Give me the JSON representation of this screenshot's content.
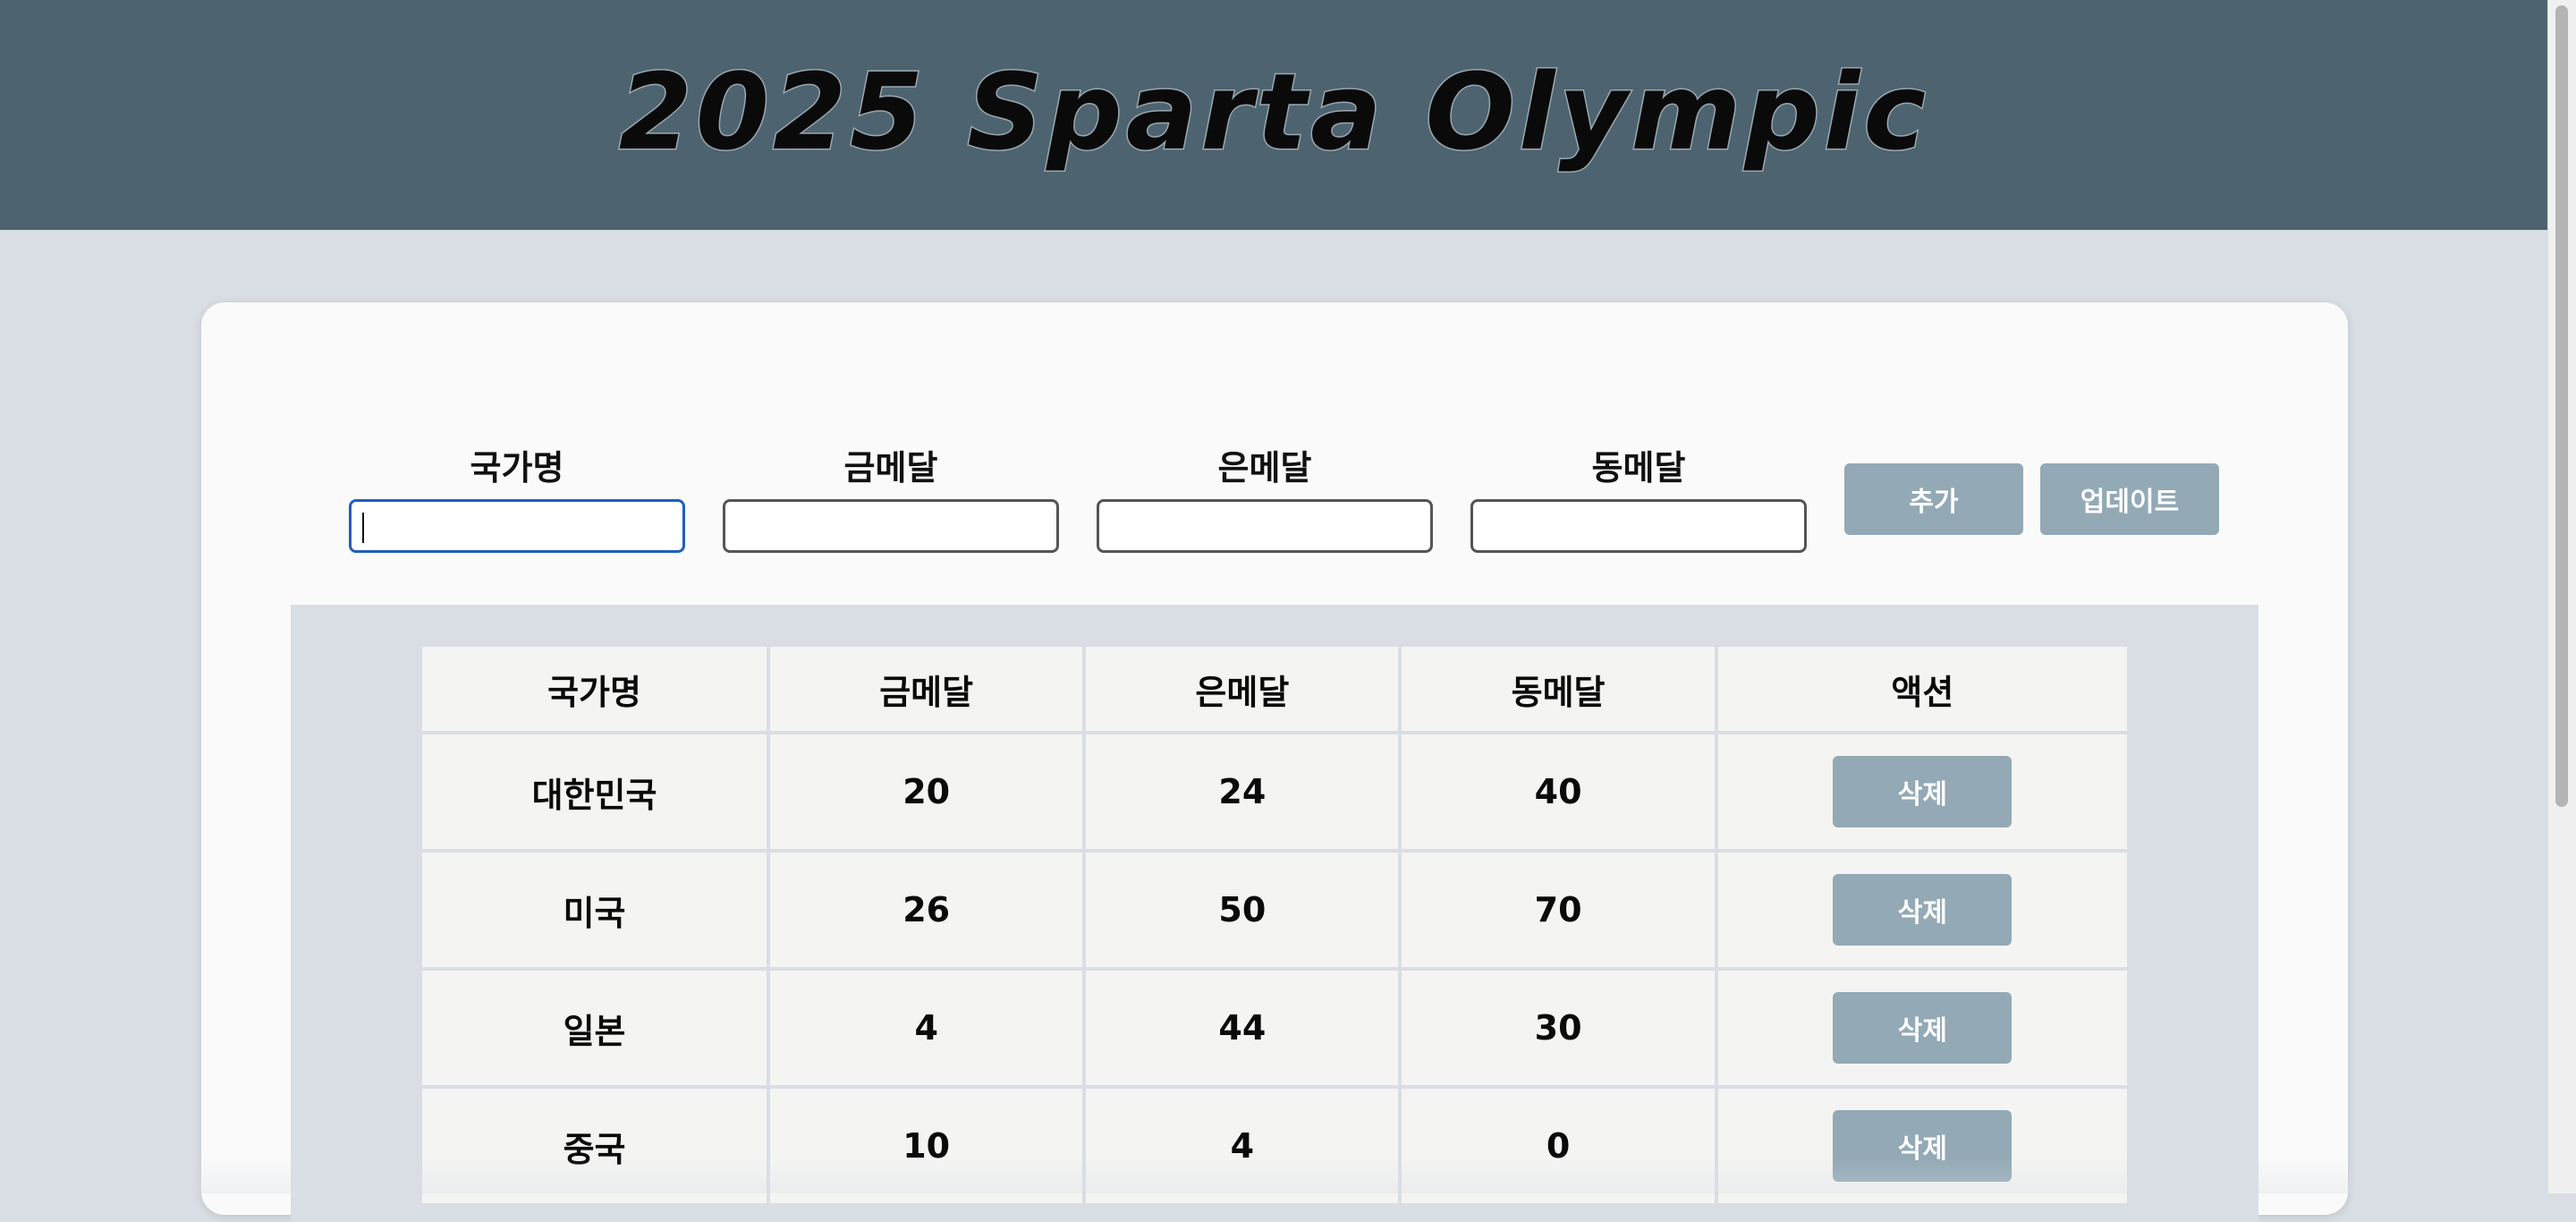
{
  "header": {
    "title": "2025 Sparta Olympic"
  },
  "form": {
    "fields": [
      {
        "label": "국가명",
        "value": ""
      },
      {
        "label": "금메달",
        "value": ""
      },
      {
        "label": "은메달",
        "value": ""
      },
      {
        "label": "동메달",
        "value": ""
      }
    ],
    "add_label": "추가",
    "update_label": "업데이트"
  },
  "table": {
    "headers": [
      "국가명",
      "금메달",
      "은메달",
      "동메달",
      "액션"
    ],
    "rows": [
      {
        "country": "대한민국",
        "gold": "20",
        "silver": "24",
        "bronze": "40",
        "action": "삭제"
      },
      {
        "country": "미국",
        "gold": "26",
        "silver": "50",
        "bronze": "70",
        "action": "삭제"
      },
      {
        "country": "일본",
        "gold": "4",
        "silver": "44",
        "bronze": "30",
        "action": "삭제"
      },
      {
        "country": "중국",
        "gold": "10",
        "silver": "4",
        "bronze": "0",
        "action": "삭제"
      }
    ]
  },
  "colors": {
    "header_bg": "#4d6470",
    "page_bg": "#d9dee4",
    "button_bg": "#93a9b5",
    "focus_border": "#1f5fbf"
  }
}
